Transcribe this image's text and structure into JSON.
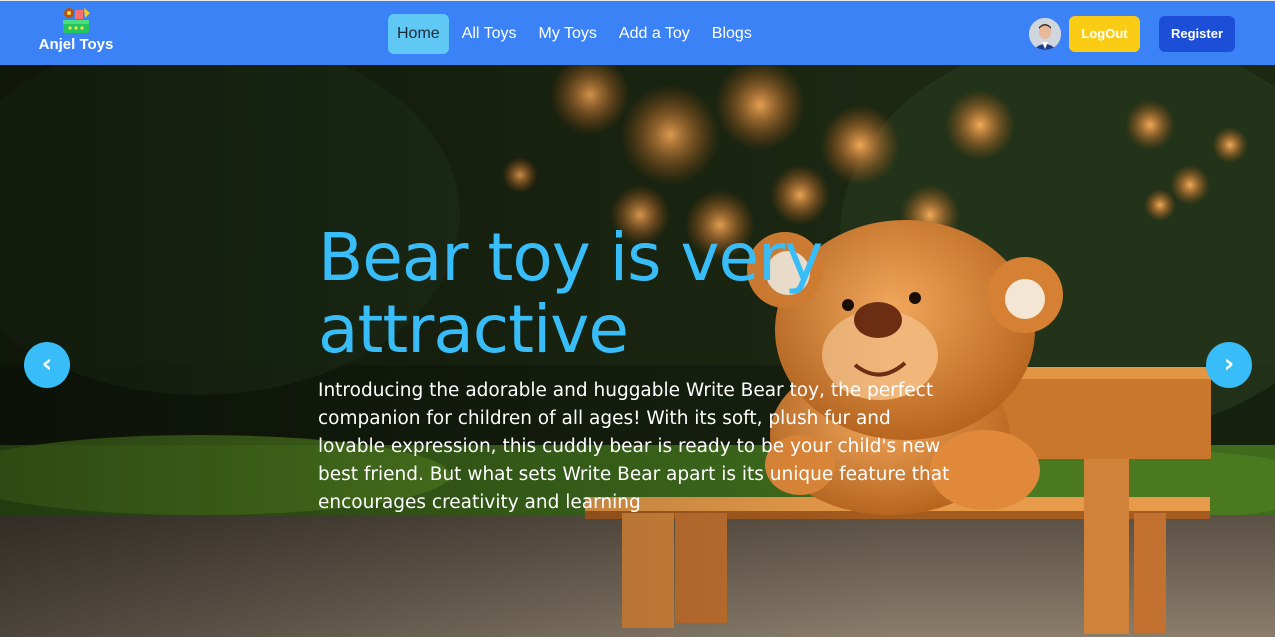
{
  "brand": {
    "name": "Anjel Toys",
    "logo_icon": "toy-basket-icon"
  },
  "nav": {
    "links": [
      {
        "label": "Home",
        "active": true
      },
      {
        "label": "All Toys",
        "active": false
      },
      {
        "label": "My Toys",
        "active": false
      },
      {
        "label": "Add a Toy",
        "active": false
      },
      {
        "label": "Blogs",
        "active": false
      }
    ]
  },
  "user": {
    "avatar_icon": "user-avatar"
  },
  "actions": {
    "logout_label": "LogOut",
    "register_label": "Register"
  },
  "hero": {
    "title": "Bear toy is very attractive",
    "description": "Introducing the adorable and huggable Write Bear toy, the perfect companion for children of all ages! With its soft, plush fur and lovable expression, this cuddly bear is ready to be your child's new best friend. But what sets Write Bear apart is its unique feature that encourages creativity and learning",
    "prev_label": "‹",
    "next_label": "›"
  },
  "colors": {
    "navbar": "#3b82f6",
    "active_link": "#60c8f5",
    "logout": "#facc15",
    "register": "#1d4ed8",
    "accent": "#38bdf8"
  }
}
